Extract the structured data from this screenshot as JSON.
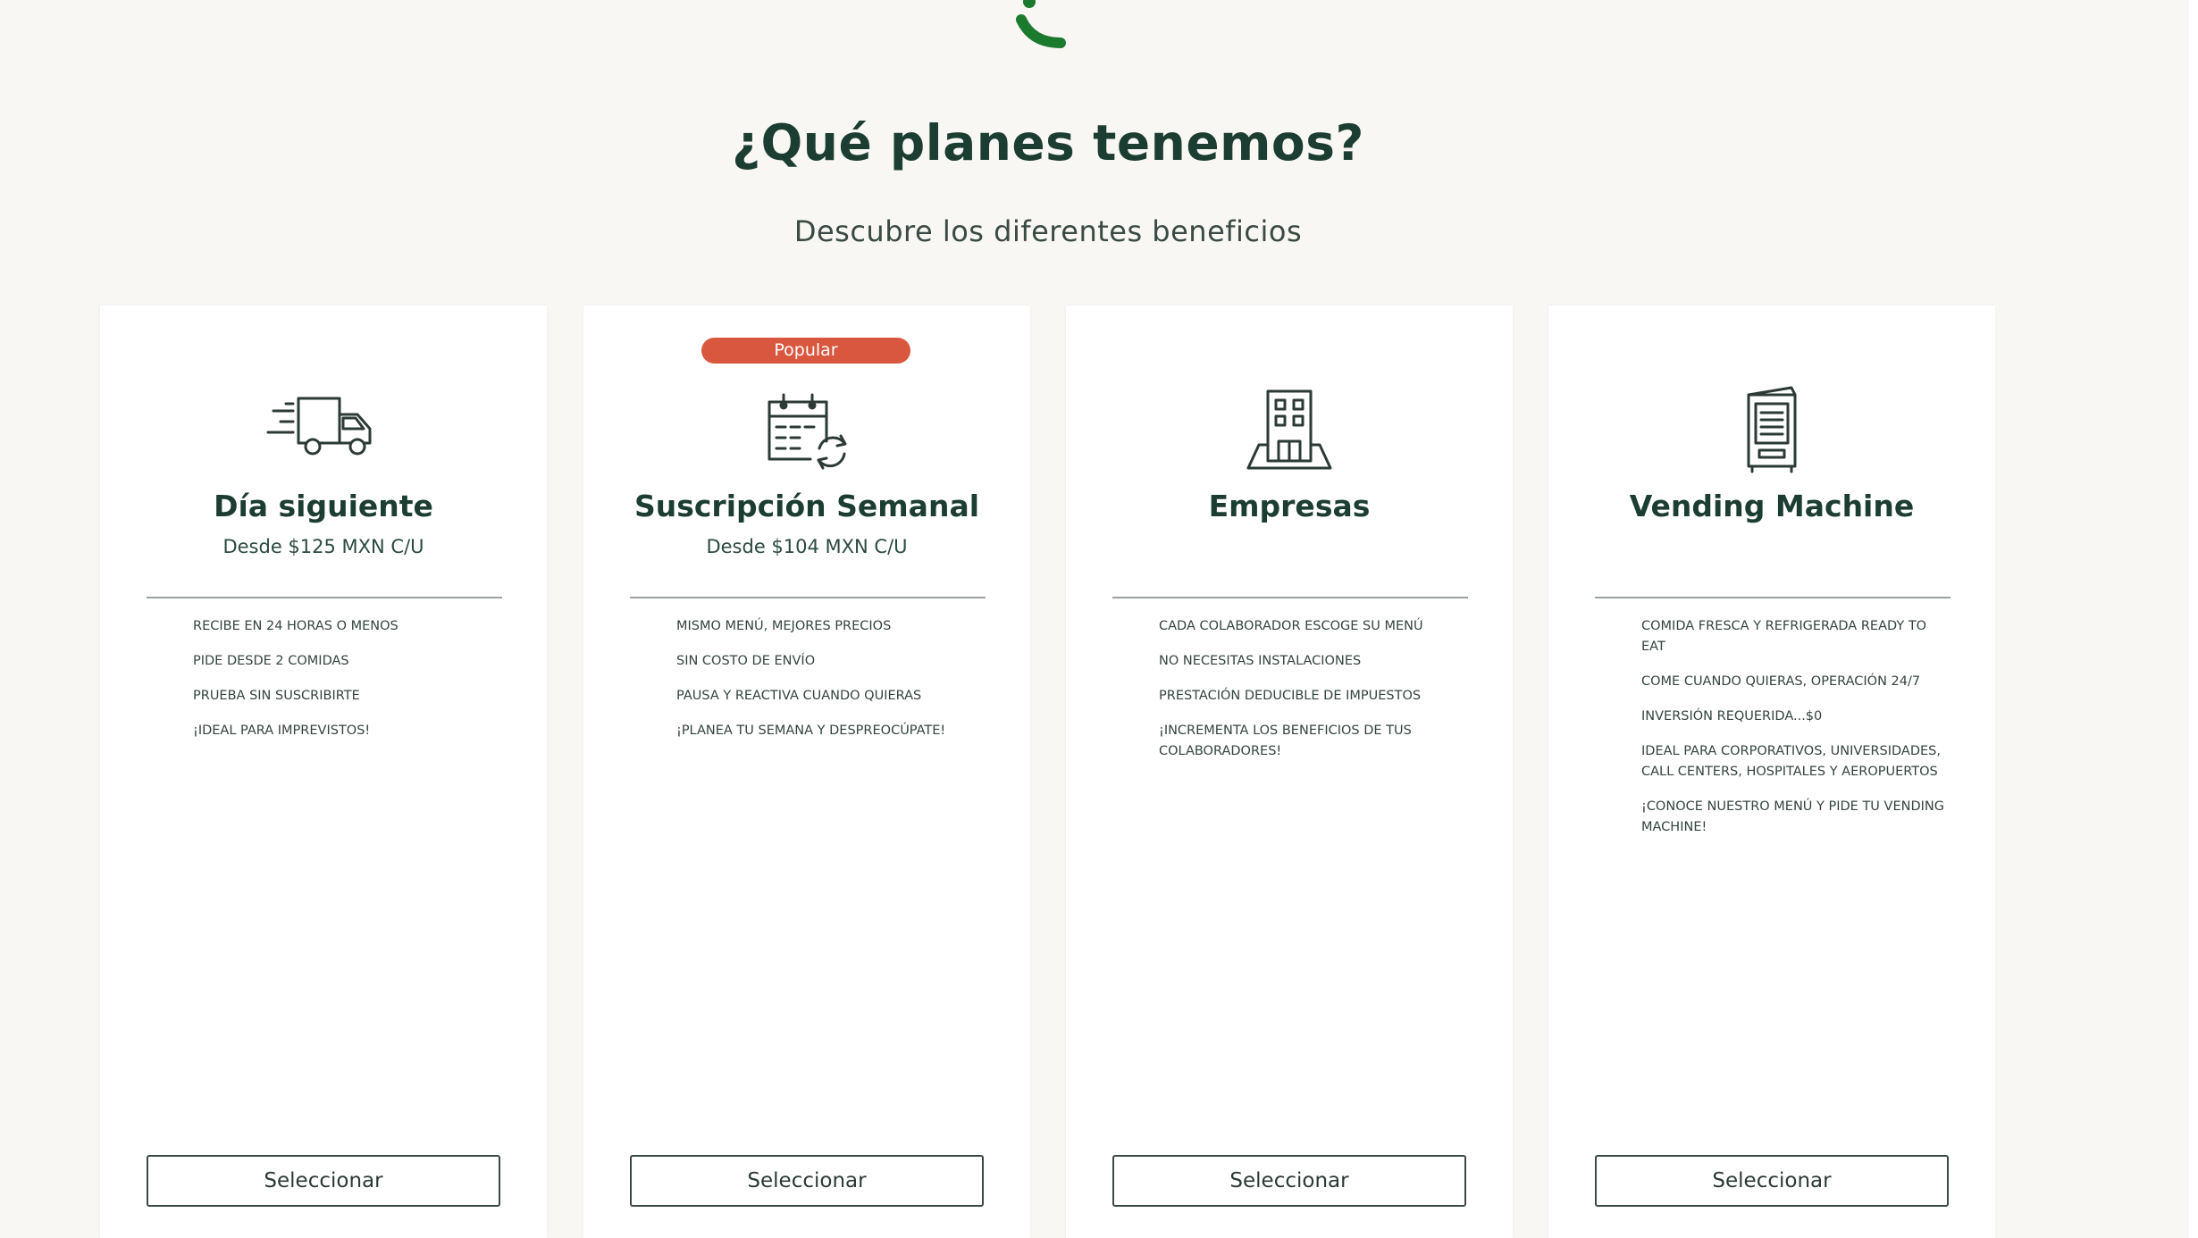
{
  "section": {
    "title": "¿Qué planes tenemos?",
    "subtitle": "Descubre los diferentes beneficios"
  },
  "colors": {
    "brand_green": "#1c7a2e",
    "heading": "#1c3d31",
    "badge": "#d9573f",
    "background": "#f8f7f4"
  },
  "plans": [
    {
      "icon": "delivery-truck-icon",
      "name": "Día siguiente",
      "price": "Desde $125 MXN C/U",
      "features": [
        "Recibe en 24 horas o menos",
        "Pide desde 2 comidas",
        "Prueba sin suscribirte",
        "¡Ideal para imprevistos!"
      ],
      "button": "Seleccionar"
    },
    {
      "badge": "Popular",
      "icon": "calendar-refresh-icon",
      "name": "Suscripción Semanal",
      "price": "Desde $104 MXN C/U",
      "features": [
        "Mismo menú, mejores precios",
        "Sin costo de envío",
        "Pausa y reactiva cuando quieras",
        "¡Planea tu semana y despreocúpate!"
      ],
      "button": "Seleccionar"
    },
    {
      "icon": "office-building-icon",
      "name": "Empresas",
      "features": [
        "Cada colaborador escoge su menú",
        "No necesitas instalaciones",
        "Prestación deducible de impuestos",
        "¡Incrementa los beneficios de tus colaboradores!"
      ],
      "button": "Seleccionar"
    },
    {
      "icon": "vending-machine-icon",
      "name": "Vending Machine",
      "features": [
        "Comida fresca y refrigerada ready to eat",
        "Come cuando quieras, operación 24/7",
        "Inversión requerida...$0",
        "Ideal para corporativos, universidades, call centers, hospitales y aeropuertos",
        "¡Conoce nuestro menú y pide tu vending machine!"
      ],
      "button": "Seleccionar"
    }
  ]
}
